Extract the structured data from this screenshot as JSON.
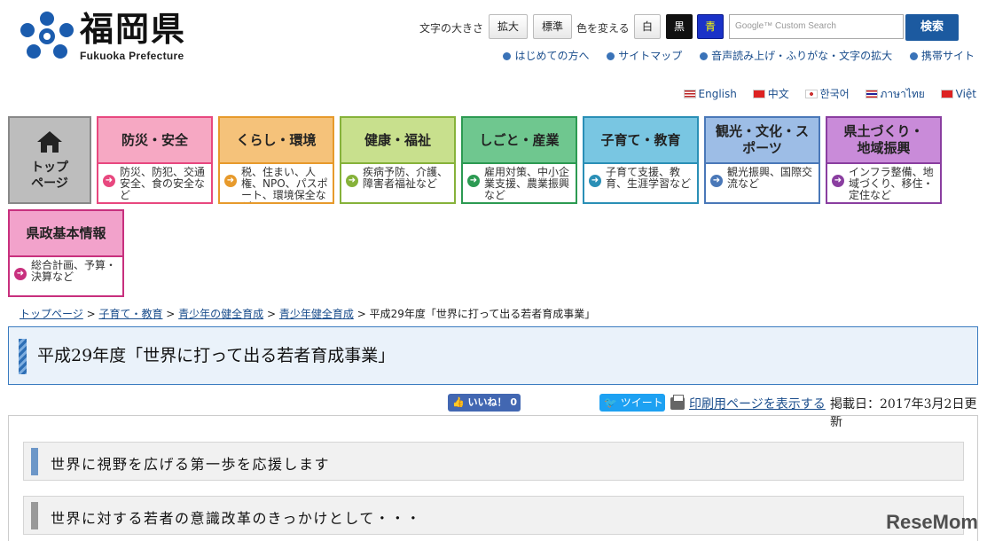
{
  "header": {
    "logo_text": "福岡県",
    "logo_sub": "Fukuoka Prefecture",
    "font_size_label": "文字の大きさ",
    "font_large": "拡大",
    "font_standard": "標準",
    "color_label": "色を変える",
    "color_white": "白",
    "color_black": "黒",
    "color_blue": "青",
    "search_placeholder": "Google™ Custom Search",
    "search_button": "検索"
  },
  "util_links": [
    "はじめての方へ",
    "サイトマップ",
    "音声読み上げ・ふりがな・文字の拡大",
    "携帯サイト"
  ],
  "languages": [
    "English",
    "中文",
    "한국어",
    "ภาษาไทย",
    "Việt"
  ],
  "nav": {
    "top": {
      "line1": "トップ",
      "line2": "ページ"
    },
    "tiles": [
      {
        "title": "防災・安全",
        "desc": "防災、防犯、交通安全、食の安全など",
        "color": "#e8487f",
        "bg": "#f6a8c3"
      },
      {
        "title": "くらし・環境",
        "desc": "税、住まい、人権、NPO、パスポート、環境保全など",
        "color": "#e79a2c",
        "bg": "#f5c27a"
      },
      {
        "title": "健康・福祉",
        "desc": "疾病予防、介護、障害者福祉など",
        "color": "#86b23a",
        "bg": "#c8e08d"
      },
      {
        "title": "しごと・産業",
        "desc": "雇用対策、中小企業支援、農業振興など",
        "color": "#2c9a52",
        "bg": "#6fc78f"
      },
      {
        "title": "子育て・教育",
        "desc": "子育て支援、教育、生涯学習など",
        "color": "#2a8fb6",
        "bg": "#79c6e2"
      },
      {
        "title": "観光・文化・スポーツ",
        "desc": "観光振興、国際交流など",
        "color": "#4a78b8",
        "bg": "#9dbde6"
      },
      {
        "title": "県土づくり・地域振興",
        "desc": "インフラ整備、地域づくり、移住・定住など",
        "color": "#8a3ea0",
        "bg": "#c98bd9"
      },
      {
        "title": "県政基本情報",
        "desc": "総合計画、予算・決算など",
        "color": "#c8307e",
        "bg": "#f2a2cb"
      }
    ]
  },
  "breadcrumb": {
    "items": [
      "トップページ",
      "子育て・教育",
      "青少年の健全育成",
      "青少年健全育成"
    ],
    "current": "平成29年度「世界に打って出る若者育成事業」",
    "sep": " > "
  },
  "page_title": "平成29年度「世界に打って出る若者育成事業」",
  "share": {
    "like_label": "いいね！ 0",
    "tweet_label": "ツイート",
    "print_label": "印刷用ページを表示する",
    "date_label": "掲載日：2017年3月2日更新"
  },
  "sections": [
    {
      "text": "世界に視野を広げる第一歩を応援します",
      "color": "#6d97c8"
    },
    {
      "text": "世界に対する若者の意識改革のきっかけとして・・・",
      "color": "#999999"
    }
  ],
  "watermark": "ReseMom"
}
